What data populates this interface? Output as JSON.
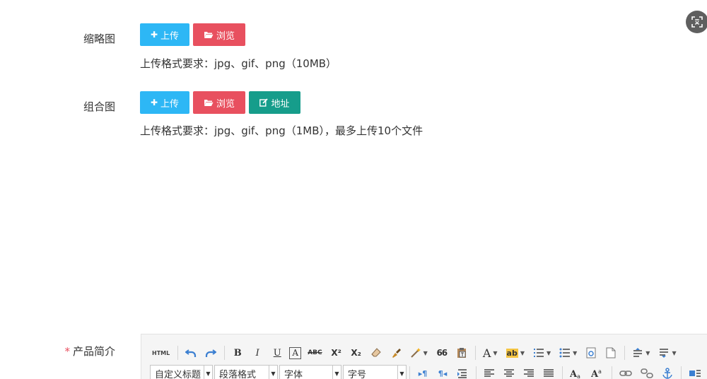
{
  "thumbnail": {
    "label": "缩略图",
    "upload_label": "上传",
    "browse_label": "浏览",
    "hint": "上传格式要求：jpg、gif、png（10MB）"
  },
  "gallery": {
    "label": "组合图",
    "upload_label": "上传",
    "browse_label": "浏览",
    "address_label": "地址",
    "hint": "上传格式要求：jpg、gif、png（1MB），最多上传10个文件"
  },
  "description": {
    "required_mark": "*",
    "label": "产品简介"
  },
  "editor": {
    "toolbar_row1": {
      "html": "HTML",
      "bold": "B",
      "italic": "I",
      "underline": "U",
      "box": "A",
      "strike": "ABC",
      "superscript": "X²",
      "subscript": "X₂",
      "quote": "66",
      "font_color": "A",
      "highlight": "ab"
    },
    "toolbar_row2": {
      "custom_title": "自定义标题",
      "paragraph": "段落格式",
      "font": "字体",
      "font_size": "字号",
      "ltr": "▸¶",
      "rtl": "¶◂"
    }
  },
  "colors": {
    "blue": "#2db7f5",
    "red": "#e8505f",
    "green": "#169d8b"
  }
}
